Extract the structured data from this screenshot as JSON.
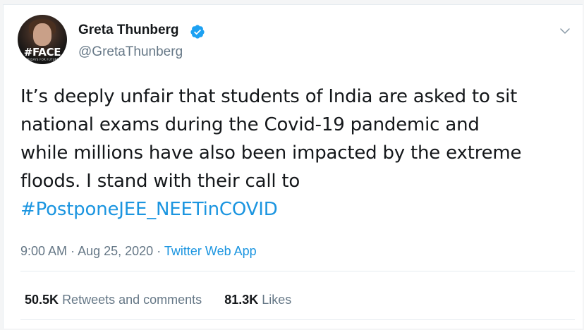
{
  "author": {
    "display_name": "Greta Thunberg",
    "handle": "@GretaThunberg",
    "avatar_badge": "#FACE",
    "avatar_badge_sub": "FRIDAYS FOR FUTURE",
    "verified_icon": "verified-badge-icon",
    "verified_color": "#1da1f2"
  },
  "tweet": {
    "text_line_1": "It’s deeply unfair that students of India are asked to sit",
    "text_line_2": "national exams during the Covid-19 pandemic and",
    "text_line_3": "while millions have also been impacted by the extreme",
    "text_line_4": "floods. I stand with their call to",
    "hashtag": "#PostponeJEE_NEETinCOVID",
    "hashtag_color": "#1b95e0"
  },
  "meta": {
    "time": "9:00 AM",
    "separator": "·",
    "date": "Aug 25, 2020",
    "source": "Twitter Web App"
  },
  "stats": {
    "retweets_count": "50.5K",
    "retweets_label": "Retweets and comments",
    "likes_count": "81.3K",
    "likes_label": "Likes"
  },
  "menu": {
    "icon": "chevron-down-icon"
  }
}
